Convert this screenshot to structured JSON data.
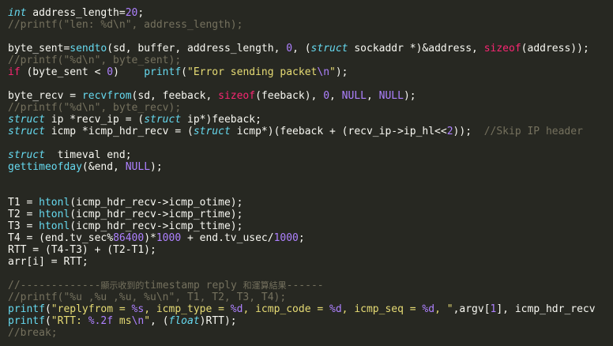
{
  "editor": {
    "lines": [
      [
        [
          "kw",
          "int"
        ],
        [
          "plain",
          " address_length="
        ],
        [
          "num",
          "20"
        ],
        [
          "plain",
          ";"
        ]
      ],
      [
        [
          "cmt",
          "//printf(\"len: %d\\n\", address_length);"
        ]
      ],
      [],
      [
        [
          "plain",
          "byte_sent="
        ],
        [
          "fn",
          "sendto"
        ],
        [
          "plain",
          "(sd, buffer, address_length, "
        ],
        [
          "num",
          "0"
        ],
        [
          "plain",
          ", ("
        ],
        [
          "kw",
          "struct"
        ],
        [
          "plain",
          " sockaddr *)&address, "
        ],
        [
          "ctl",
          "sizeof"
        ],
        [
          "plain",
          "(address));"
        ]
      ],
      [
        [
          "cmt",
          "//printf(\"%d\\n\", byte_sent);"
        ]
      ],
      [
        [
          "ctl",
          "if"
        ],
        [
          "plain",
          " (byte_sent < "
        ],
        [
          "num",
          "0"
        ],
        [
          "plain",
          ")    "
        ],
        [
          "fn",
          "printf"
        ],
        [
          "plain",
          "("
        ],
        [
          "str",
          "\"Error sending packet"
        ],
        [
          "fmt",
          "\\n"
        ],
        [
          "str",
          "\""
        ],
        [
          "plain",
          ");"
        ]
      ],
      [],
      [
        [
          "plain",
          "byte_recv = "
        ],
        [
          "fn",
          "recvfrom"
        ],
        [
          "plain",
          "(sd, feeback, "
        ],
        [
          "ctl",
          "sizeof"
        ],
        [
          "plain",
          "(feeback), "
        ],
        [
          "num",
          "0"
        ],
        [
          "plain",
          ", "
        ],
        [
          "mac",
          "NULL"
        ],
        [
          "plain",
          ", "
        ],
        [
          "mac",
          "NULL"
        ],
        [
          "plain",
          ");"
        ]
      ],
      [
        [
          "cmt",
          "//printf(\"%d\\n\", byte_recv);"
        ]
      ],
      [
        [
          "kw",
          "struct"
        ],
        [
          "plain",
          " ip *recv_ip = ("
        ],
        [
          "kw",
          "struct"
        ],
        [
          "plain",
          " ip*)feeback;"
        ]
      ],
      [
        [
          "kw",
          "struct"
        ],
        [
          "plain",
          " icmp *icmp_hdr_recv = ("
        ],
        [
          "kw",
          "struct"
        ],
        [
          "plain",
          " icmp*)(feeback + (recv_ip->ip_hl<<"
        ],
        [
          "num",
          "2"
        ],
        [
          "plain",
          "));  "
        ],
        [
          "cmt",
          "//Skip IP header"
        ]
      ],
      [],
      [
        [
          "kw",
          "struct"
        ],
        [
          "plain",
          "  timeval end;"
        ]
      ],
      [
        [
          "fn",
          "gettimeofday"
        ],
        [
          "plain",
          "(&end, "
        ],
        [
          "mac",
          "NULL"
        ],
        [
          "plain",
          ");"
        ]
      ],
      [],
      [],
      [
        [
          "plain",
          "T1 = "
        ],
        [
          "fn",
          "htonl"
        ],
        [
          "plain",
          "(icmp_hdr_recv->icmp_otime);"
        ]
      ],
      [
        [
          "plain",
          "T2 = "
        ],
        [
          "fn",
          "htonl"
        ],
        [
          "plain",
          "(icmp_hdr_recv->icmp_rtime);"
        ]
      ],
      [
        [
          "plain",
          "T3 = "
        ],
        [
          "fn",
          "htonl"
        ],
        [
          "plain",
          "(icmp_hdr_recv->icmp_ttime);"
        ]
      ],
      [
        [
          "plain",
          "T4 = (end.tv_sec%"
        ],
        [
          "num",
          "86400"
        ],
        [
          "plain",
          ")*"
        ],
        [
          "num",
          "1000"
        ],
        [
          "plain",
          " + end.tv_usec/"
        ],
        [
          "num",
          "1000"
        ],
        [
          "plain",
          ";"
        ]
      ],
      [
        [
          "plain",
          "RTT = (T4-T3) + (T2-T1);"
        ]
      ],
      [
        [
          "plain",
          "arr[i] = RTT;"
        ]
      ],
      [],
      [
        [
          "cmt",
          "//-------------"
        ],
        [
          "cmt cjk",
          "顯示收到的"
        ],
        [
          "cmt",
          "timestamp reply "
        ],
        [
          "cmt cjk",
          "和運算結果"
        ],
        [
          "cmt",
          "------"
        ]
      ],
      [
        [
          "cmt",
          "//printf(\"%u ,%u ,%u, %u\\n\", T1, T2, T3, T4);"
        ]
      ],
      [
        [
          "fn",
          "printf"
        ],
        [
          "plain",
          "("
        ],
        [
          "str",
          "\"replyfrom = "
        ],
        [
          "fmt",
          "%s"
        ],
        [
          "str",
          ", icmp_type = "
        ],
        [
          "fmt",
          "%d"
        ],
        [
          "str",
          ", icmp_code = "
        ],
        [
          "fmt",
          "%d"
        ],
        [
          "str",
          ", icmp_seq = "
        ],
        [
          "fmt",
          "%d"
        ],
        [
          "str",
          ", \""
        ],
        [
          "plain",
          ",argv["
        ],
        [
          "num",
          "1"
        ],
        [
          "plain",
          "], icmp_hdr_recv"
        ]
      ],
      [
        [
          "fn",
          "printf"
        ],
        [
          "plain",
          "("
        ],
        [
          "str",
          "\"RTT: "
        ],
        [
          "fmt",
          "%.2f"
        ],
        [
          "str",
          " ms"
        ],
        [
          "fmt",
          "\\n"
        ],
        [
          "str",
          "\""
        ],
        [
          "plain",
          ", ("
        ],
        [
          "kw",
          "float"
        ],
        [
          "plain",
          ")RTT);"
        ]
      ],
      [
        [
          "cmt",
          "//break;"
        ]
      ]
    ]
  }
}
